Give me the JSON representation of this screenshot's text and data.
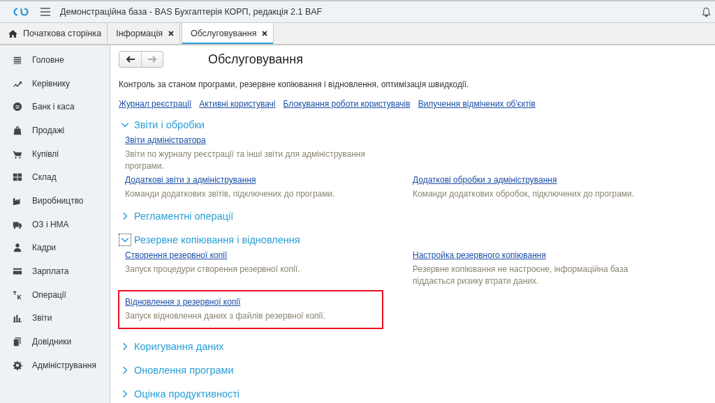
{
  "window": {
    "title": "Демонстраційна база - BAS Бухгалтерія КОРП, редакція 2.1 BAF"
  },
  "tabs": [
    {
      "label": "Початкова сторінка",
      "kind": "home",
      "selected": false
    },
    {
      "label": "Інформація",
      "kind": "closable",
      "selected": false
    },
    {
      "label": "Обслуговування",
      "kind": "closable",
      "selected": true
    }
  ],
  "sidebar": {
    "items": [
      {
        "label": "Головне"
      },
      {
        "label": "Керівнику"
      },
      {
        "label": "Банк і каса"
      },
      {
        "label": "Продажі"
      },
      {
        "label": "Купівлі"
      },
      {
        "label": "Склад"
      },
      {
        "label": "Виробництво"
      },
      {
        "label": "ОЗ і НМА"
      },
      {
        "label": "Кадри"
      },
      {
        "label": "Зарплата"
      },
      {
        "label": "Операції"
      },
      {
        "label": "Звіти"
      },
      {
        "label": "Довідники"
      },
      {
        "label": "Адміністрування"
      }
    ]
  },
  "page": {
    "title": "Обслуговування",
    "description": "Контроль за станом програми, резервне копіювання і відновлення, оптимізація швидкодії.",
    "links": [
      "Журнал реєстрації",
      "Активні користувачі",
      "Блокування роботи користувачів",
      "Вилучення відмічених об'єктів"
    ],
    "sections": [
      {
        "title": "Звіти і обробки",
        "expanded": true,
        "focused": false,
        "rows": [
          [
            {
              "link": "Звіти адміністратора",
              "description": "Звіти по журналу реєстрації та інші звіти для адміністрування програми.",
              "highlighted": false
            }
          ],
          [
            {
              "link": "Додаткові звіти з адміністрування",
              "description": "Команди додаткових звітів, підключених до програми.",
              "highlighted": false
            },
            {
              "link": "Додаткові обробки з адміністрування",
              "description": "Команди додаткових обробок, підключених до програми.",
              "highlighted": false
            }
          ]
        ]
      },
      {
        "title": "Регламентні операції",
        "expanded": false,
        "focused": false
      },
      {
        "title": "Резервне копіювання і відновлення",
        "expanded": true,
        "focused": true,
        "rows": [
          [
            {
              "link": "Створення резервної копії",
              "description": "Запуск процедури створення резервної копії.",
              "highlighted": false
            },
            {
              "link": "Настройка резервного копіювання",
              "description": "Резервне копіювання не настроєне, інформаційна база піддається ризику втрати даних.",
              "highlighted": false
            }
          ],
          [
            {
              "link": "Відновлення з резервної копії",
              "description": "Запуск відновлення даних з файлів резервної копії.",
              "highlighted": true
            }
          ]
        ]
      },
      {
        "title": "Коригування даних",
        "expanded": false,
        "focused": false
      },
      {
        "title": "Оновлення програми",
        "expanded": false,
        "focused": false
      },
      {
        "title": "Оцінка продуктивності",
        "expanded": false,
        "focused": false
      }
    ]
  }
}
